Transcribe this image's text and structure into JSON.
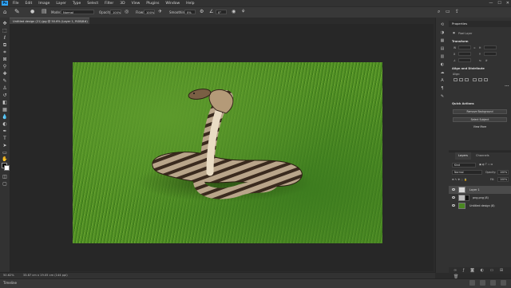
{
  "menu": {
    "logo": "Ps",
    "items": [
      "File",
      "Edit",
      "Image",
      "Layer",
      "Type",
      "Select",
      "Filter",
      "3D",
      "View",
      "Plugins",
      "Window",
      "Help"
    ],
    "window_controls": [
      "—",
      "☐",
      "✕"
    ]
  },
  "options": {
    "mode_label": "Mode:",
    "mode_value": "Normal",
    "opacity_label": "Opacity:",
    "opacity_value": "100%",
    "flow_label": "Flow:",
    "flow_value": "100%",
    "smoothing_label": "Smoothing:",
    "smoothing_value": "0%",
    "angle_value": "0°"
  },
  "document": {
    "tab_title": "Untitled design (21).jpg @ 50.6% (Layer 1, RGB/8#) *",
    "close": "✕"
  },
  "status": {
    "zoom": "50.62%",
    "doc_size": "33.87 cm x 19.05 cm (144 ppi)"
  },
  "timeline": {
    "label": "Timeline"
  },
  "properties": {
    "title": "Properties",
    "layer_kind": "Pixel Layer",
    "transform_title": "Transform",
    "align_title": "Align and Distribute",
    "align_label": "Align:",
    "quick_actions_title": "Quick Actions",
    "remove_bg": "Remove Background",
    "select_subject": "Select Subject",
    "view_more": "View More"
  },
  "layers": {
    "tabs": [
      "Layers",
      "Channels"
    ],
    "search": "Kind",
    "blend": "Normal",
    "opacity_label": "Opacity:",
    "opacity_value": "100%",
    "fill_label": "Fill:",
    "fill_value": "100%",
    "items": [
      {
        "name": "Layer 1",
        "selected": true
      },
      {
        "name": "png.png (8)",
        "selected": false
      },
      {
        "name": "Untitled design (8)",
        "selected": false
      }
    ]
  },
  "colors": {
    "accent": "#31a8ff",
    "panel": "#323232",
    "pasteboard": "#272727"
  }
}
